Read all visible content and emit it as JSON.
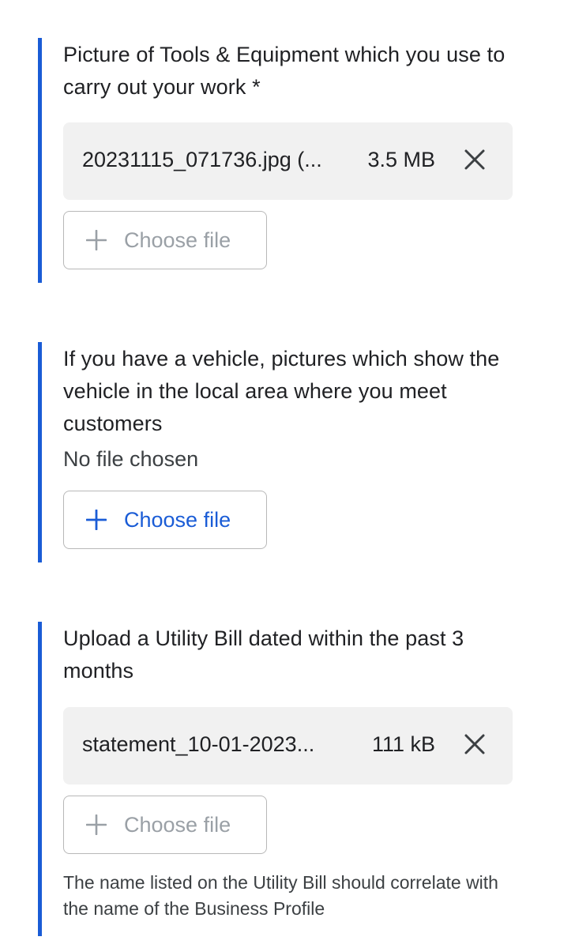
{
  "sections": [
    {
      "question": "Picture of Tools & Equipment which you use to carry out your work *",
      "file": {
        "name": "20231115_071736.jpg (...",
        "size": "3.5 MB"
      },
      "choose_label": "Choose file",
      "choose_enabled": false
    },
    {
      "question": "If you have a vehicle, pictures which show the vehicle in the local area where you meet customers",
      "status": "No file chosen",
      "choose_label": "Choose file",
      "choose_enabled": true
    },
    {
      "question": "Upload a Utility Bill dated within the past 3 months",
      "file": {
        "name": "statement_10-01-2023...",
        "size": "111 kB"
      },
      "choose_label": "Choose file",
      "choose_enabled": false,
      "helper": "The name listed on the Utility Bill should correlate with the name of the Business Profile"
    }
  ],
  "colors": {
    "accent": "#1a5cd6",
    "chip_background": "#f1f1f1",
    "disabled_text": "#9aa0a6"
  },
  "icons": {
    "remove": "close-icon",
    "add": "plus-icon"
  }
}
